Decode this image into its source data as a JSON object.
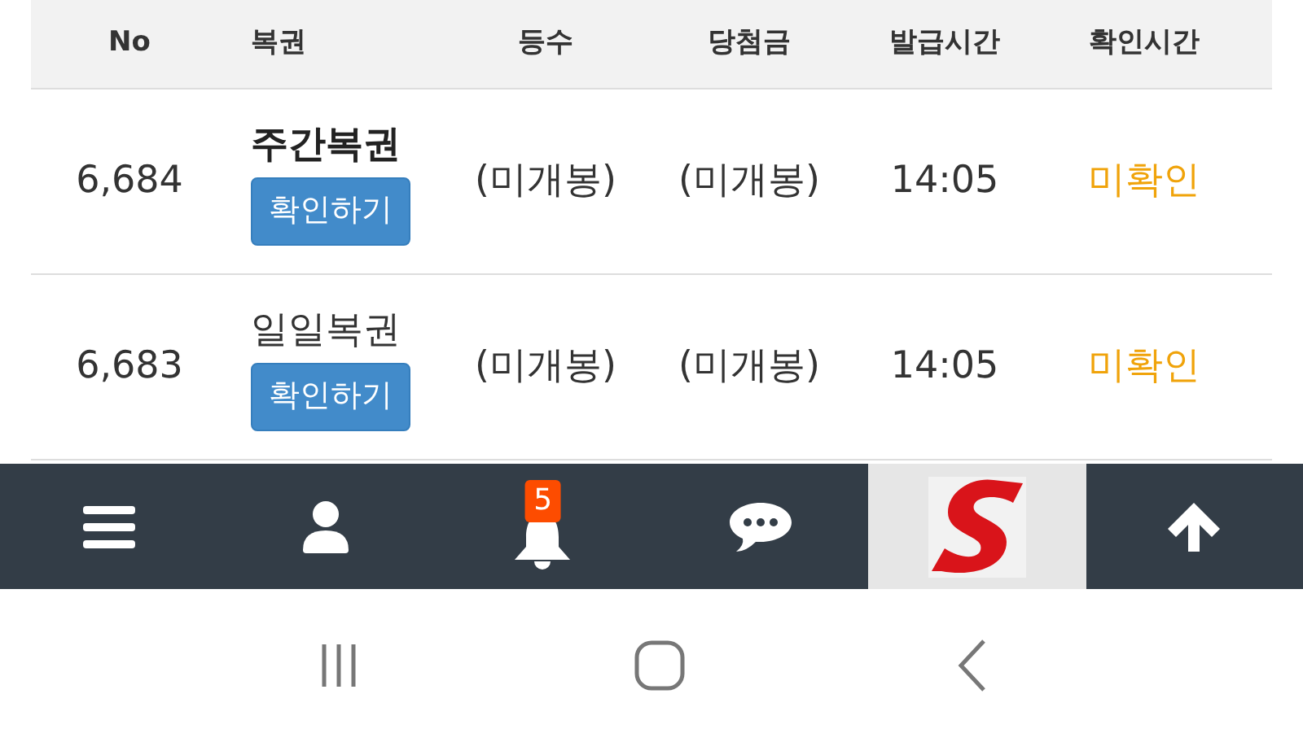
{
  "table": {
    "columns": [
      "No",
      "복권",
      "등수",
      "당첨금",
      "발급시간",
      "확인시간"
    ],
    "rows": [
      {
        "no": "6,684",
        "ticket": "주간복권",
        "emphasized": true,
        "button": "확인하기",
        "rank": "(미개봉)",
        "prize": "(미개봉)",
        "issued": "14:05",
        "status": "미확인",
        "confirmed": false
      },
      {
        "no": "6,683",
        "ticket": "일일복권",
        "emphasized": false,
        "button": "확인하기",
        "rank": "(미개봉)",
        "prize": "(미개봉)",
        "issued": "14:05",
        "status": "미확인",
        "confirmed": false
      }
    ]
  },
  "bottom_bar": {
    "items": [
      {
        "kind": "menu"
      },
      {
        "kind": "user"
      },
      {
        "kind": "bell",
        "badge": "5"
      },
      {
        "kind": "chat"
      },
      {
        "kind": "logo"
      },
      {
        "kind": "top"
      }
    ]
  }
}
